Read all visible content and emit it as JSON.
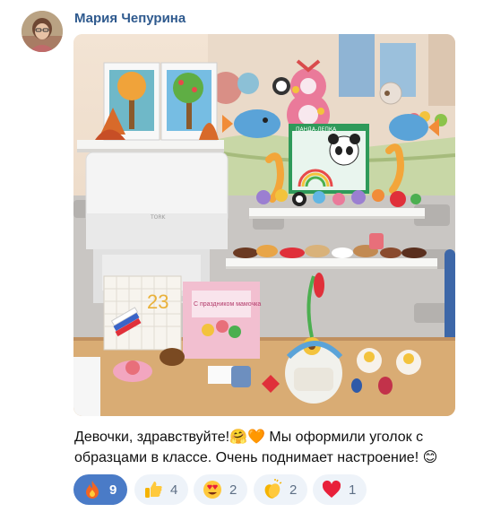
{
  "post": {
    "author": "Мария Чепурина",
    "text_line1": "Девочки, здравствуйте!🤗🧡 Мы оформили уголок с",
    "text_line2": "образцами  в классе. Очень поднимает настроение! 😊"
  },
  "photo": {
    "board_label": "23",
    "panda_sign": "ПАНДА-ЛЕПКА",
    "card_label": "С праздником мамочка"
  },
  "reactions": [
    {
      "name": "fire-icon",
      "count": "9",
      "active": true
    },
    {
      "name": "thumbs-up-icon",
      "count": "4",
      "active": false
    },
    {
      "name": "heart-eyes-icon",
      "count": "2",
      "active": false
    },
    {
      "name": "clapping-icon",
      "count": "2",
      "active": false
    },
    {
      "name": "heart-icon",
      "count": "1",
      "active": false
    }
  ],
  "colors": {
    "author": "#2f5a8e",
    "reaction_active": "#4a7bc7",
    "reaction_bg": "#eef3f9"
  }
}
